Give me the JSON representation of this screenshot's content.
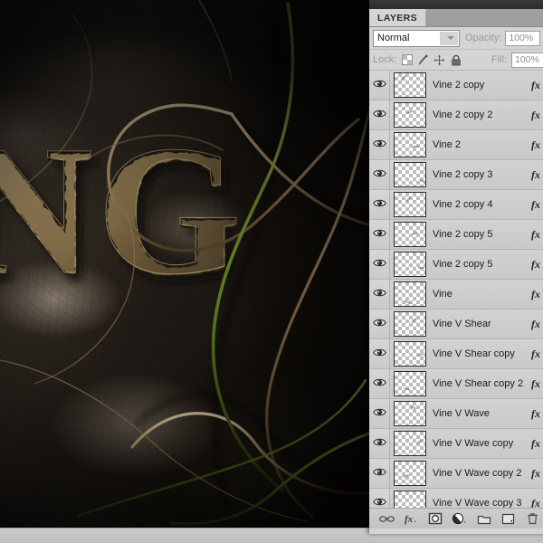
{
  "app": {
    "panel_title": "LAYERS"
  },
  "panel": {
    "blend_mode": "Normal",
    "blend_mode_options": [
      "Normal"
    ],
    "opacity_label": "Opacity:",
    "opacity_value": "100%",
    "lock_label": "Lock:",
    "lock_icons": [
      "lock-transparency-icon",
      "lock-pixels-icon",
      "lock-position-icon",
      "lock-all-icon"
    ],
    "fill_label": "Fill:",
    "fill_value": "100%",
    "fx_label": "fx"
  },
  "layers": [
    {
      "name": "Vine 2 copy",
      "visible": true,
      "has_fx": true
    },
    {
      "name": "Vine 2 copy 2",
      "visible": true,
      "has_fx": true
    },
    {
      "name": "Vine 2",
      "visible": true,
      "has_fx": true
    },
    {
      "name": "Vine 2 copy 3",
      "visible": true,
      "has_fx": true
    },
    {
      "name": "Vine 2 copy 4",
      "visible": true,
      "has_fx": true
    },
    {
      "name": "Vine 2 copy 5",
      "visible": true,
      "has_fx": true
    },
    {
      "name": "Vine 2 copy 5",
      "visible": true,
      "has_fx": true
    },
    {
      "name": "Vine",
      "visible": true,
      "has_fx": true
    },
    {
      "name": "Vine V Shear",
      "visible": true,
      "has_fx": true
    },
    {
      "name": "Vine V Shear copy",
      "visible": true,
      "has_fx": true
    },
    {
      "name": "Vine V Shear copy 2",
      "visible": true,
      "has_fx": true
    },
    {
      "name": "Vine V Wave",
      "visible": true,
      "has_fx": true
    },
    {
      "name": "Vine V Wave copy",
      "visible": true,
      "has_fx": true
    },
    {
      "name": "Vine V Wave copy 2",
      "visible": true,
      "has_fx": true
    },
    {
      "name": "Vine V Wave copy 3",
      "visible": true,
      "has_fx": true
    }
  ],
  "footer": {
    "buttons": [
      "link-layers-icon",
      "add-layer-style-icon",
      "add-layer-mask-icon",
      "new-adjustment-layer-icon",
      "new-group-icon",
      "new-layer-icon",
      "delete-layer-icon"
    ]
  },
  "artwork": {
    "carved_text": "NG",
    "description": "stone-carved-letters-with-vines",
    "colors": {
      "stone_light": "#bdae99",
      "stone_dark": "#14100c",
      "vine_tan": "#c8ae88",
      "vine_green": "#7f9a2e",
      "letter_gold": "#a8906a"
    }
  }
}
